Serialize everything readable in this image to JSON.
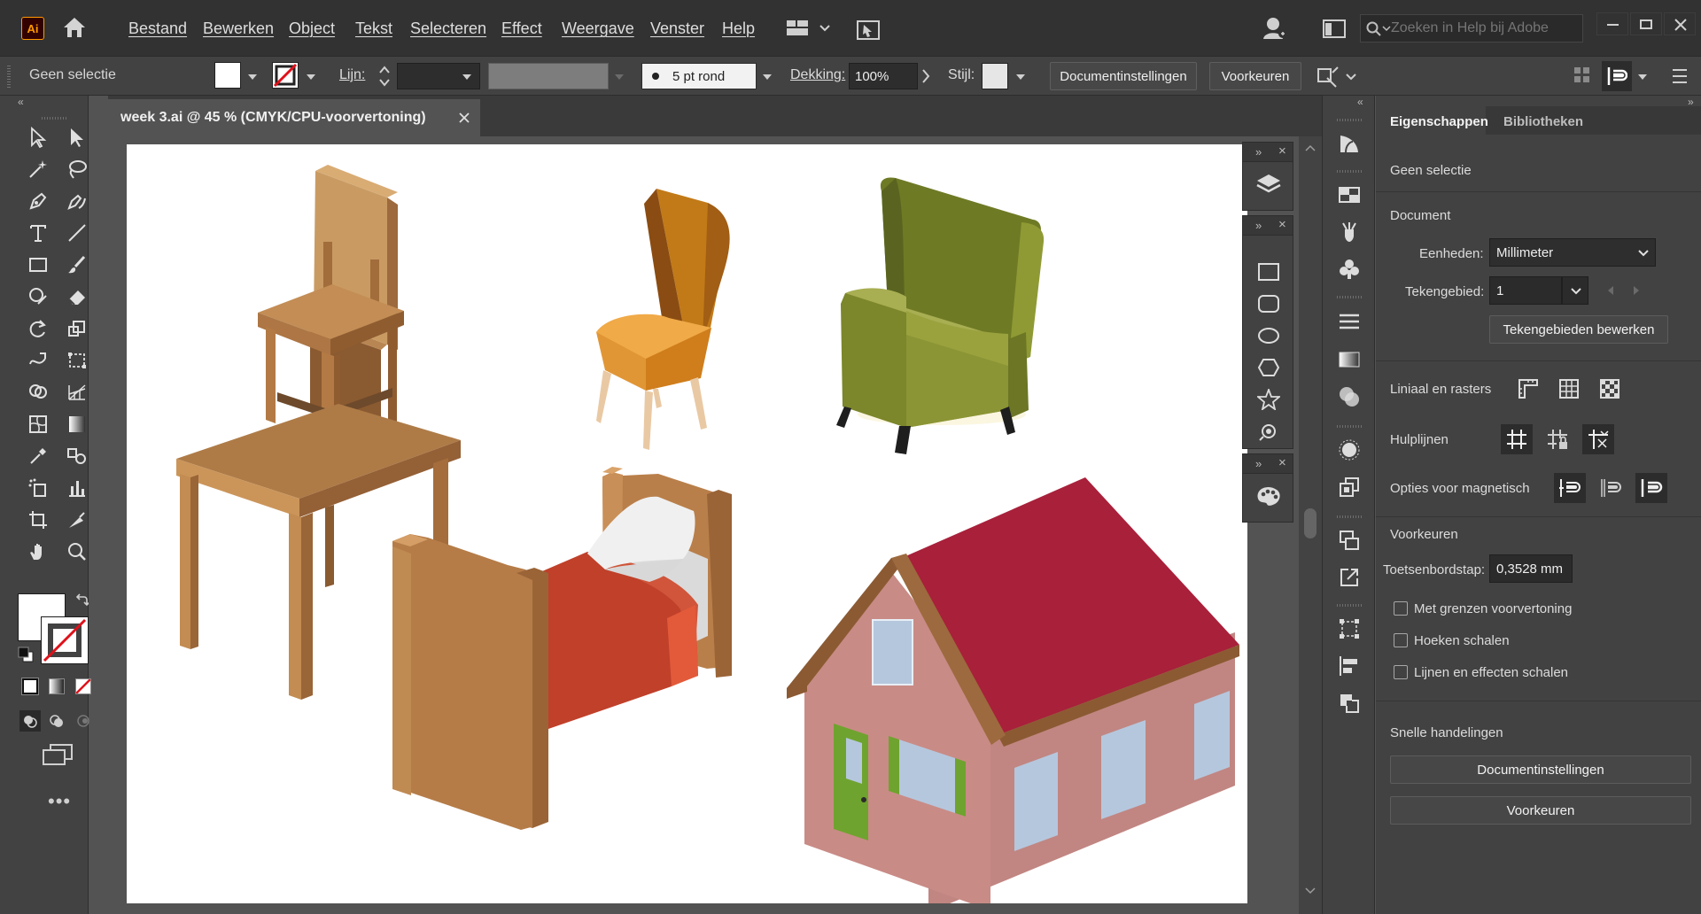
{
  "app": {
    "logo_text": "Ai",
    "menu": [
      "Bestand",
      "Bewerken",
      "Object",
      "Tekst",
      "Selecteren",
      "Effect",
      "Weergave",
      "Venster",
      "Help"
    ],
    "search_placeholder": "Zoeken in Help bij Adobe"
  },
  "control_bar": {
    "selection_label": "Geen selectie",
    "stroke_label": "Lijn:",
    "brush_label": "5 pt rond",
    "opacity_label": "Dekking:",
    "opacity_value": "100%",
    "style_label": "Stijl:",
    "doc_settings_button": "Documentinstellingen",
    "preferences_button": "Voorkeuren"
  },
  "document": {
    "tab_title": "week 3.ai @ 45 % (CMYK/CPU-voorvertoning)"
  },
  "properties": {
    "tabs": [
      "Eigenschappen",
      "Bibliotheken"
    ],
    "no_selection": "Geen selectie",
    "document_heading": "Document",
    "units_label": "Eenheden:",
    "units_value": "Millimeter",
    "artboard_label": "Tekengebied:",
    "artboard_value": "1",
    "edit_artboards_button": "Tekengebieden bewerken",
    "rulers_grids_label": "Liniaal en rasters",
    "guides_label": "Hulplijnen",
    "snap_label": "Opties voor magnetisch",
    "preferences_heading": "Voorkeuren",
    "keyboard_increment_label": "Toetsenbordstap:",
    "keyboard_increment_value": "0,3528 mm",
    "checkboxes": [
      "Met grenzen voorvertoning",
      "Hoeken schalen",
      "Lijnen en effecten schalen"
    ],
    "quick_actions_heading": "Snelle handelingen",
    "quick_doc_settings_button": "Documentinstellingen",
    "quick_preferences_button": "Voorkeuren"
  },
  "colors": {
    "accent_logo_bg": "#330000",
    "accent_logo_text": "#ff9a00",
    "house_roof": "#a8203a",
    "house_wall": "#c98b86",
    "bed_blanket": "#c0402a",
    "armchair": "#7e8a2c",
    "wood": "#b77d4a"
  }
}
